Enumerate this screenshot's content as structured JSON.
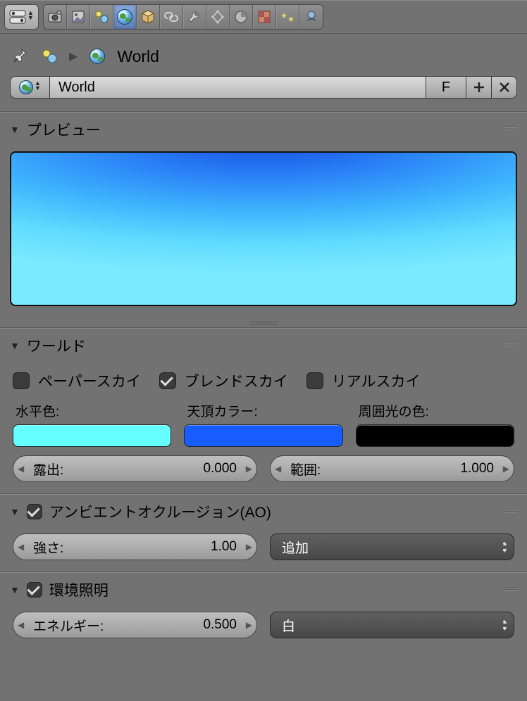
{
  "breadcrumb": {
    "label": "World"
  },
  "datablock": {
    "name": "World",
    "fake_user_label": "F"
  },
  "panels": {
    "preview": {
      "title": "プレビュー"
    },
    "world": {
      "title": "ワールド",
      "checks": {
        "paper_sky": {
          "label": "ペーパースカイ",
          "checked": false
        },
        "blend_sky": {
          "label": "ブレンドスカイ",
          "checked": true
        },
        "real_sky": {
          "label": "リアルスカイ",
          "checked": false
        }
      },
      "colors": {
        "horizon": {
          "label": "水平色:",
          "hex": "#66ffff"
        },
        "zenith": {
          "label": "天頂カラー:",
          "hex": "#175cff"
        },
        "ambient": {
          "label": "周囲光の色:",
          "hex": "#000000"
        }
      },
      "exposure": {
        "label": "露出:",
        "value": "0.000"
      },
      "range": {
        "label": "範囲:",
        "value": "1.000"
      }
    },
    "ao": {
      "title": "アンビエントオクルージョン(AO)",
      "enabled": true,
      "factor": {
        "label": "強さ:",
        "value": "1.00"
      },
      "blend_mode": "追加"
    },
    "env": {
      "title": "環境照明",
      "enabled": true,
      "energy": {
        "label": "エネルギー:",
        "value": "0.500"
      },
      "color_mode": "白"
    }
  },
  "tabs": {
    "names": [
      "render",
      "render-layers",
      "scene",
      "world",
      "object",
      "constraints",
      "modifiers",
      "object-data",
      "material",
      "texture",
      "particles",
      "physics"
    ]
  }
}
